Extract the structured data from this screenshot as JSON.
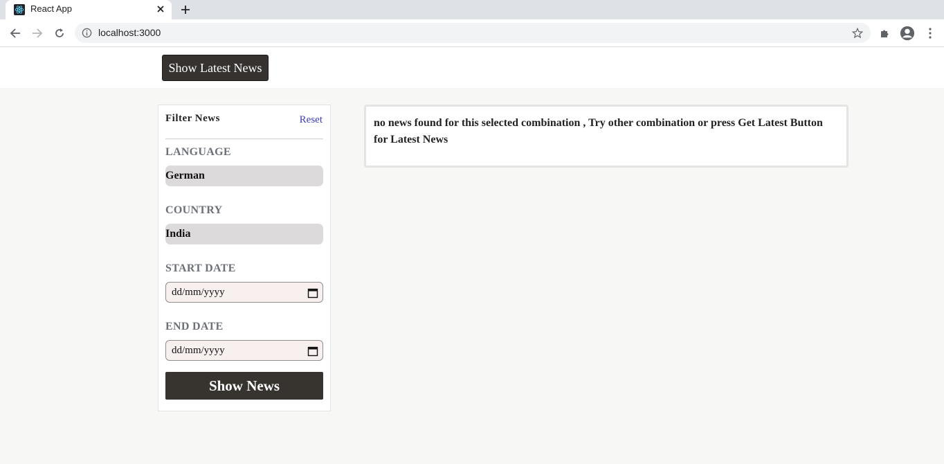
{
  "browser": {
    "tab_title": "React App",
    "url": "localhost:3000"
  },
  "header": {
    "latest_button_label": "Show Latest News"
  },
  "filter": {
    "title": "Filter News",
    "reset_label": "Reset",
    "language": {
      "label": "LANGUAGE",
      "value": "German"
    },
    "country": {
      "label": "COUNTRY",
      "value": "India"
    },
    "start_date": {
      "label": "START DATE",
      "placeholder": "dd/mm/yyyy"
    },
    "end_date": {
      "label": "END DATE",
      "placeholder": "dd/mm/yyyy"
    },
    "show_button_label": "Show News"
  },
  "news": {
    "message": "no news found for this selected combination , Try other combination or press Get Latest Button for Latest News"
  },
  "icons": [
    "react-favicon-icon",
    "close-icon",
    "plus-icon",
    "back-arrow-icon",
    "forward-arrow-icon",
    "reload-icon",
    "info-icon",
    "star-icon",
    "puzzle-icon",
    "account-icon",
    "more-vert-icon",
    "calendar-icon"
  ]
}
